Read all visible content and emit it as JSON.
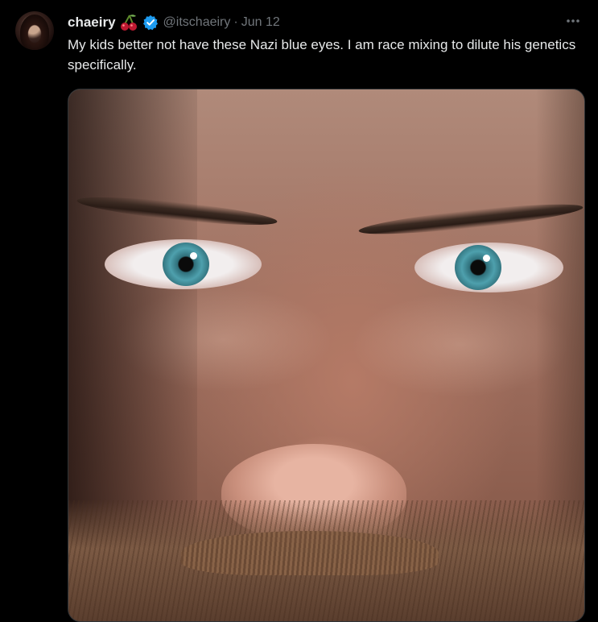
{
  "tweet": {
    "display_name": "chaeiry",
    "handle": "@itschaeiry",
    "separator": "·",
    "date": "Jun 12",
    "text": "My kids better not have these Nazi blue eyes. I am race mixing to dilute his genetics specifically.",
    "name_emoji": "cherry-icon",
    "verified": true
  },
  "colors": {
    "background": "#000000",
    "text_primary": "#e7e9ea",
    "text_secondary": "#71767b",
    "verified_blue": "#1d9bf0"
  }
}
